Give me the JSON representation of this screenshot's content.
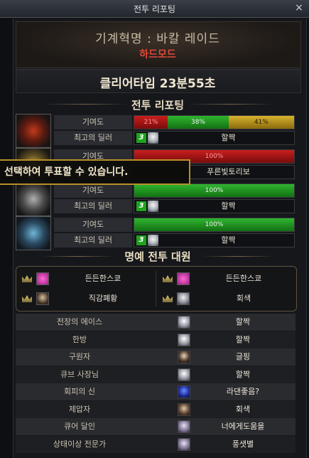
{
  "window": {
    "title": "전투 리포팅",
    "close_label": "×"
  },
  "header": {
    "raid_title": "기계혁명 : 바칼 레이드",
    "mode": "하드모드"
  },
  "clear": {
    "label": "클리어타임",
    "time": "23분55초",
    "text": "클리어타임  23분55초"
  },
  "report": {
    "title": "전투 리포팅",
    "contribution_label": "기여도",
    "best_dealer_label": "최고의 딜러",
    "parties": [
      {
        "emblem": "red-emblem-icon",
        "segments": [
          {
            "pct": 21,
            "label": "21%",
            "color": "red"
          },
          {
            "pct": 38,
            "label": "38%",
            "color": "green"
          },
          {
            "pct": 41,
            "label": "41%",
            "color": "gold"
          }
        ],
        "dealer_tag": "3",
        "dealer": "할짝"
      },
      {
        "emblem": "gold-emblem-icon",
        "segments": [
          {
            "pct": 100,
            "label": "100%",
            "color": "red"
          }
        ],
        "dealer_tag": "",
        "dealer": "푸른빛토리보"
      },
      {
        "emblem": "gray-emblem-icon",
        "segments": [
          {
            "pct": 100,
            "label": "100%",
            "color": "green"
          }
        ],
        "dealer_tag": "3",
        "dealer": "할짝"
      },
      {
        "emblem": "blue-emblem-icon",
        "segments": [
          {
            "pct": 100,
            "label": "100%",
            "color": "green"
          }
        ],
        "dealer_tag": "3",
        "dealer": "할짝"
      }
    ]
  },
  "tooltip": {
    "text": "선택하여 투표할 수 있습니다."
  },
  "mvp": {
    "title": "명예 전투 대원",
    "entries": [
      {
        "name": "든든한스쿄",
        "icon": "pink"
      },
      {
        "name": "든든한스쿄",
        "icon": "pink"
      },
      {
        "name": "직감폐황",
        "icon": "dark"
      },
      {
        "name": "회색",
        "icon": "face"
      }
    ]
  },
  "titles": [
    {
      "title": "전장의 에이스",
      "player": "할짝",
      "icon": "white"
    },
    {
      "title": "한방",
      "player": "할짝",
      "icon": "white"
    },
    {
      "title": "구원자",
      "player": "글핑",
      "icon": "dark"
    },
    {
      "title": "큐브 사장님",
      "player": "할짝",
      "icon": "white"
    },
    {
      "title": "회피의 신",
      "player": "라댄좋음?",
      "icon": "blue"
    },
    {
      "title": "제압자",
      "player": "회색",
      "icon": "brown"
    },
    {
      "title": "큐어 달인",
      "player": "너에게도움을",
      "icon": "silver"
    },
    {
      "title": "상태이상 전문가",
      "player": "풍샛별",
      "icon": "silver"
    }
  ],
  "colors": {
    "accent_gold": "#b8902a",
    "mode_red": "#e0493a",
    "bar_green": "#2fb52f",
    "bar_red": "#c81e1e",
    "bar_gold": "#d8b42e"
  }
}
